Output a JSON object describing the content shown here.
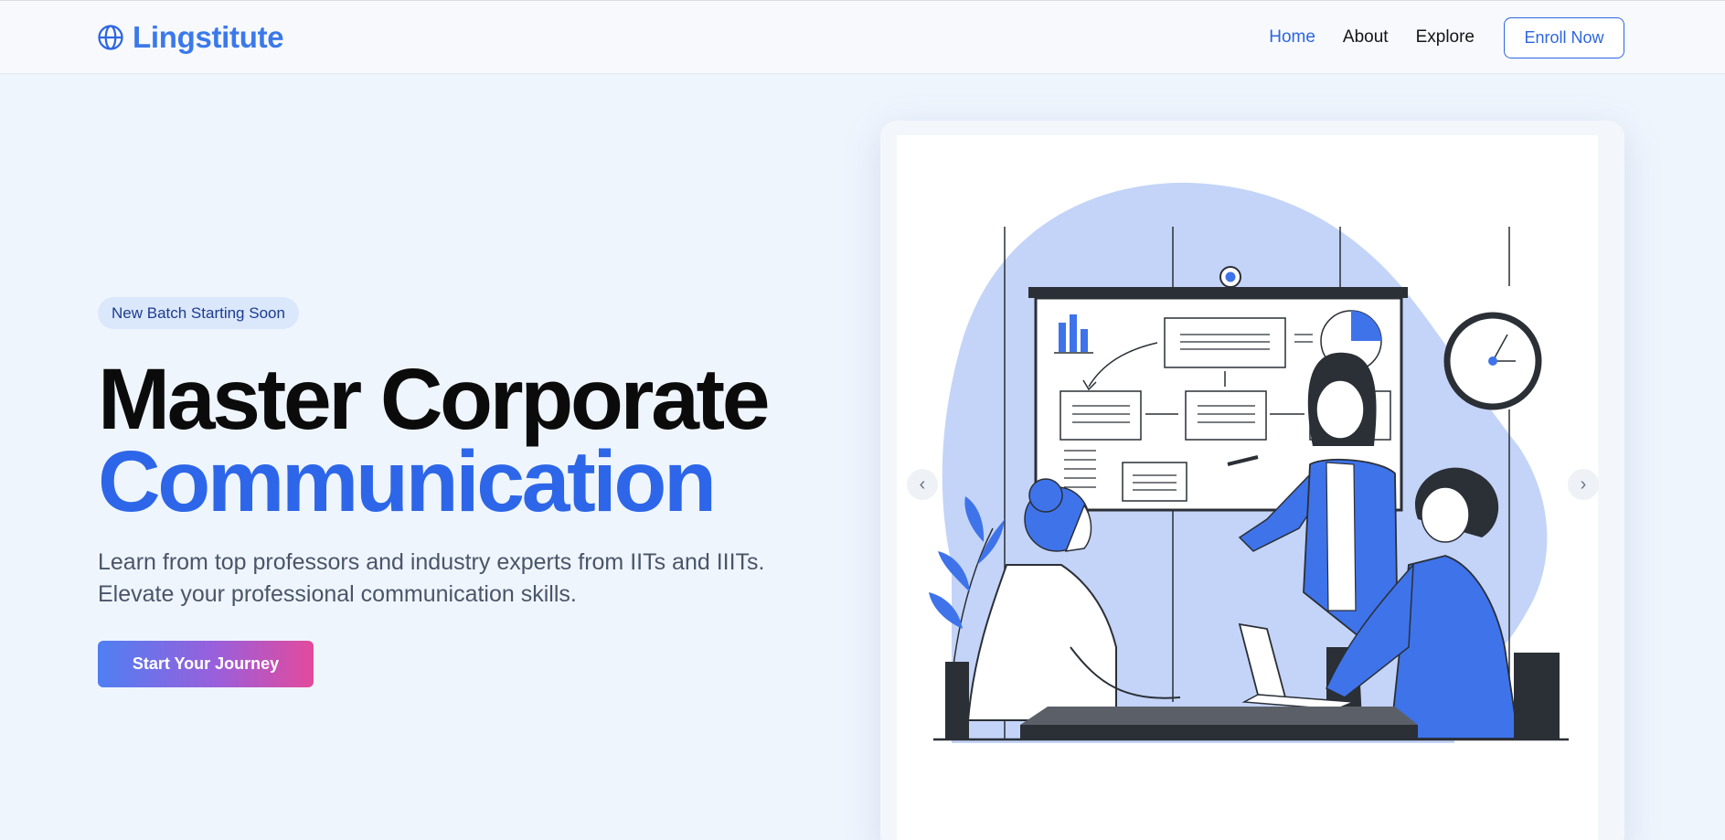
{
  "brand": {
    "name": "Lingstitute",
    "icon": "globe-icon",
    "color": "#3b79ea"
  },
  "nav": {
    "links": [
      {
        "label": "Home",
        "active": true
      },
      {
        "label": "About",
        "active": false
      },
      {
        "label": "Explore",
        "active": false
      }
    ],
    "cta_label": "Enroll Now"
  },
  "hero": {
    "badge": "New Batch Starting Soon",
    "title_line1": "Master Corporate",
    "title_line2": "Communication",
    "description": "Learn from top professors and industry experts from IITs and IIITs. Elevate your professional communication skills.",
    "cta_label": "Start Your Journey"
  },
  "carousel": {
    "prev_icon": "chevron-left-icon",
    "next_icon": "chevron-right-icon",
    "prev_glyph": "‹",
    "next_glyph": "›",
    "slide_illustration": "business-presentation-illustration"
  },
  "colors": {
    "accent": "#2d66e8",
    "background": "#eff5fd",
    "badge_bg": "#dbe7fb",
    "cta_gradient": [
      "#4f7ff2",
      "#9a5fdb",
      "#e34a9c"
    ],
    "illustration_blob": "#c3d4f8",
    "illustration_blue": "#3e73ea"
  }
}
